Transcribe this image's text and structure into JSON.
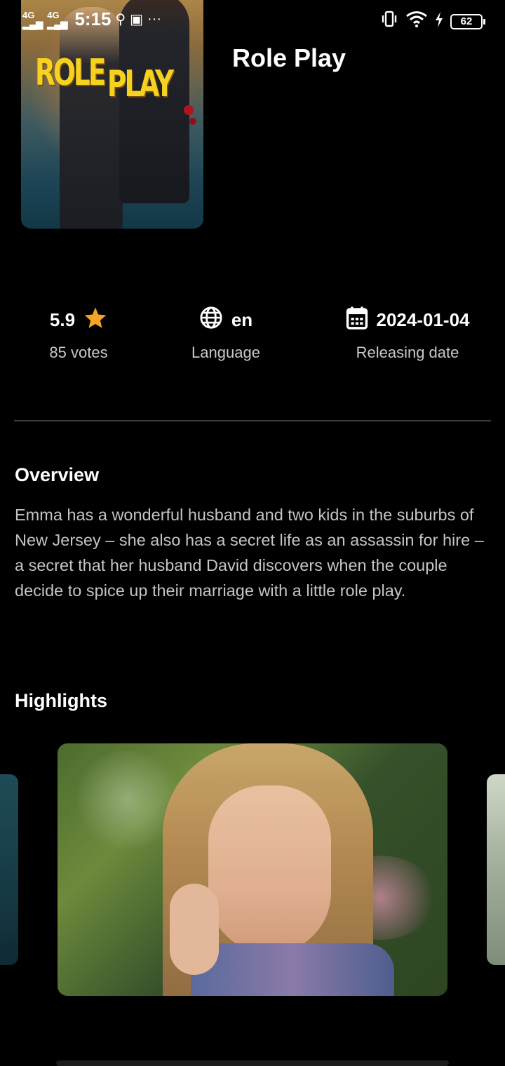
{
  "status_bar": {
    "network_1": "4G",
    "network_2": "4G",
    "time": "5:15",
    "more": "···",
    "battery": "62"
  },
  "movie": {
    "title": "Role Play",
    "poster_logo_word1": "ROLE",
    "poster_logo_word2": "PLAY"
  },
  "stats": {
    "rating": "5.9",
    "votes": "85 votes",
    "language": "en",
    "language_label": "Language",
    "release_date": "2024-01-04",
    "release_label": "Releasing date"
  },
  "overview": {
    "title": "Overview",
    "text": "Emma has a wonderful husband and two kids in the suburbs of New Jersey – she also has a secret life as an assassin for hire – a secret that her husband David discovers when the couple decide to spice up their marriage with a little role play."
  },
  "highlights": {
    "title": "Highlights"
  },
  "colors": {
    "accent_star": "#F4A524",
    "background": "#000000",
    "muted_text": "#C4C4C4"
  },
  "icons": {
    "rating": "star-icon",
    "language": "globe-icon",
    "date": "calendar-icon"
  }
}
